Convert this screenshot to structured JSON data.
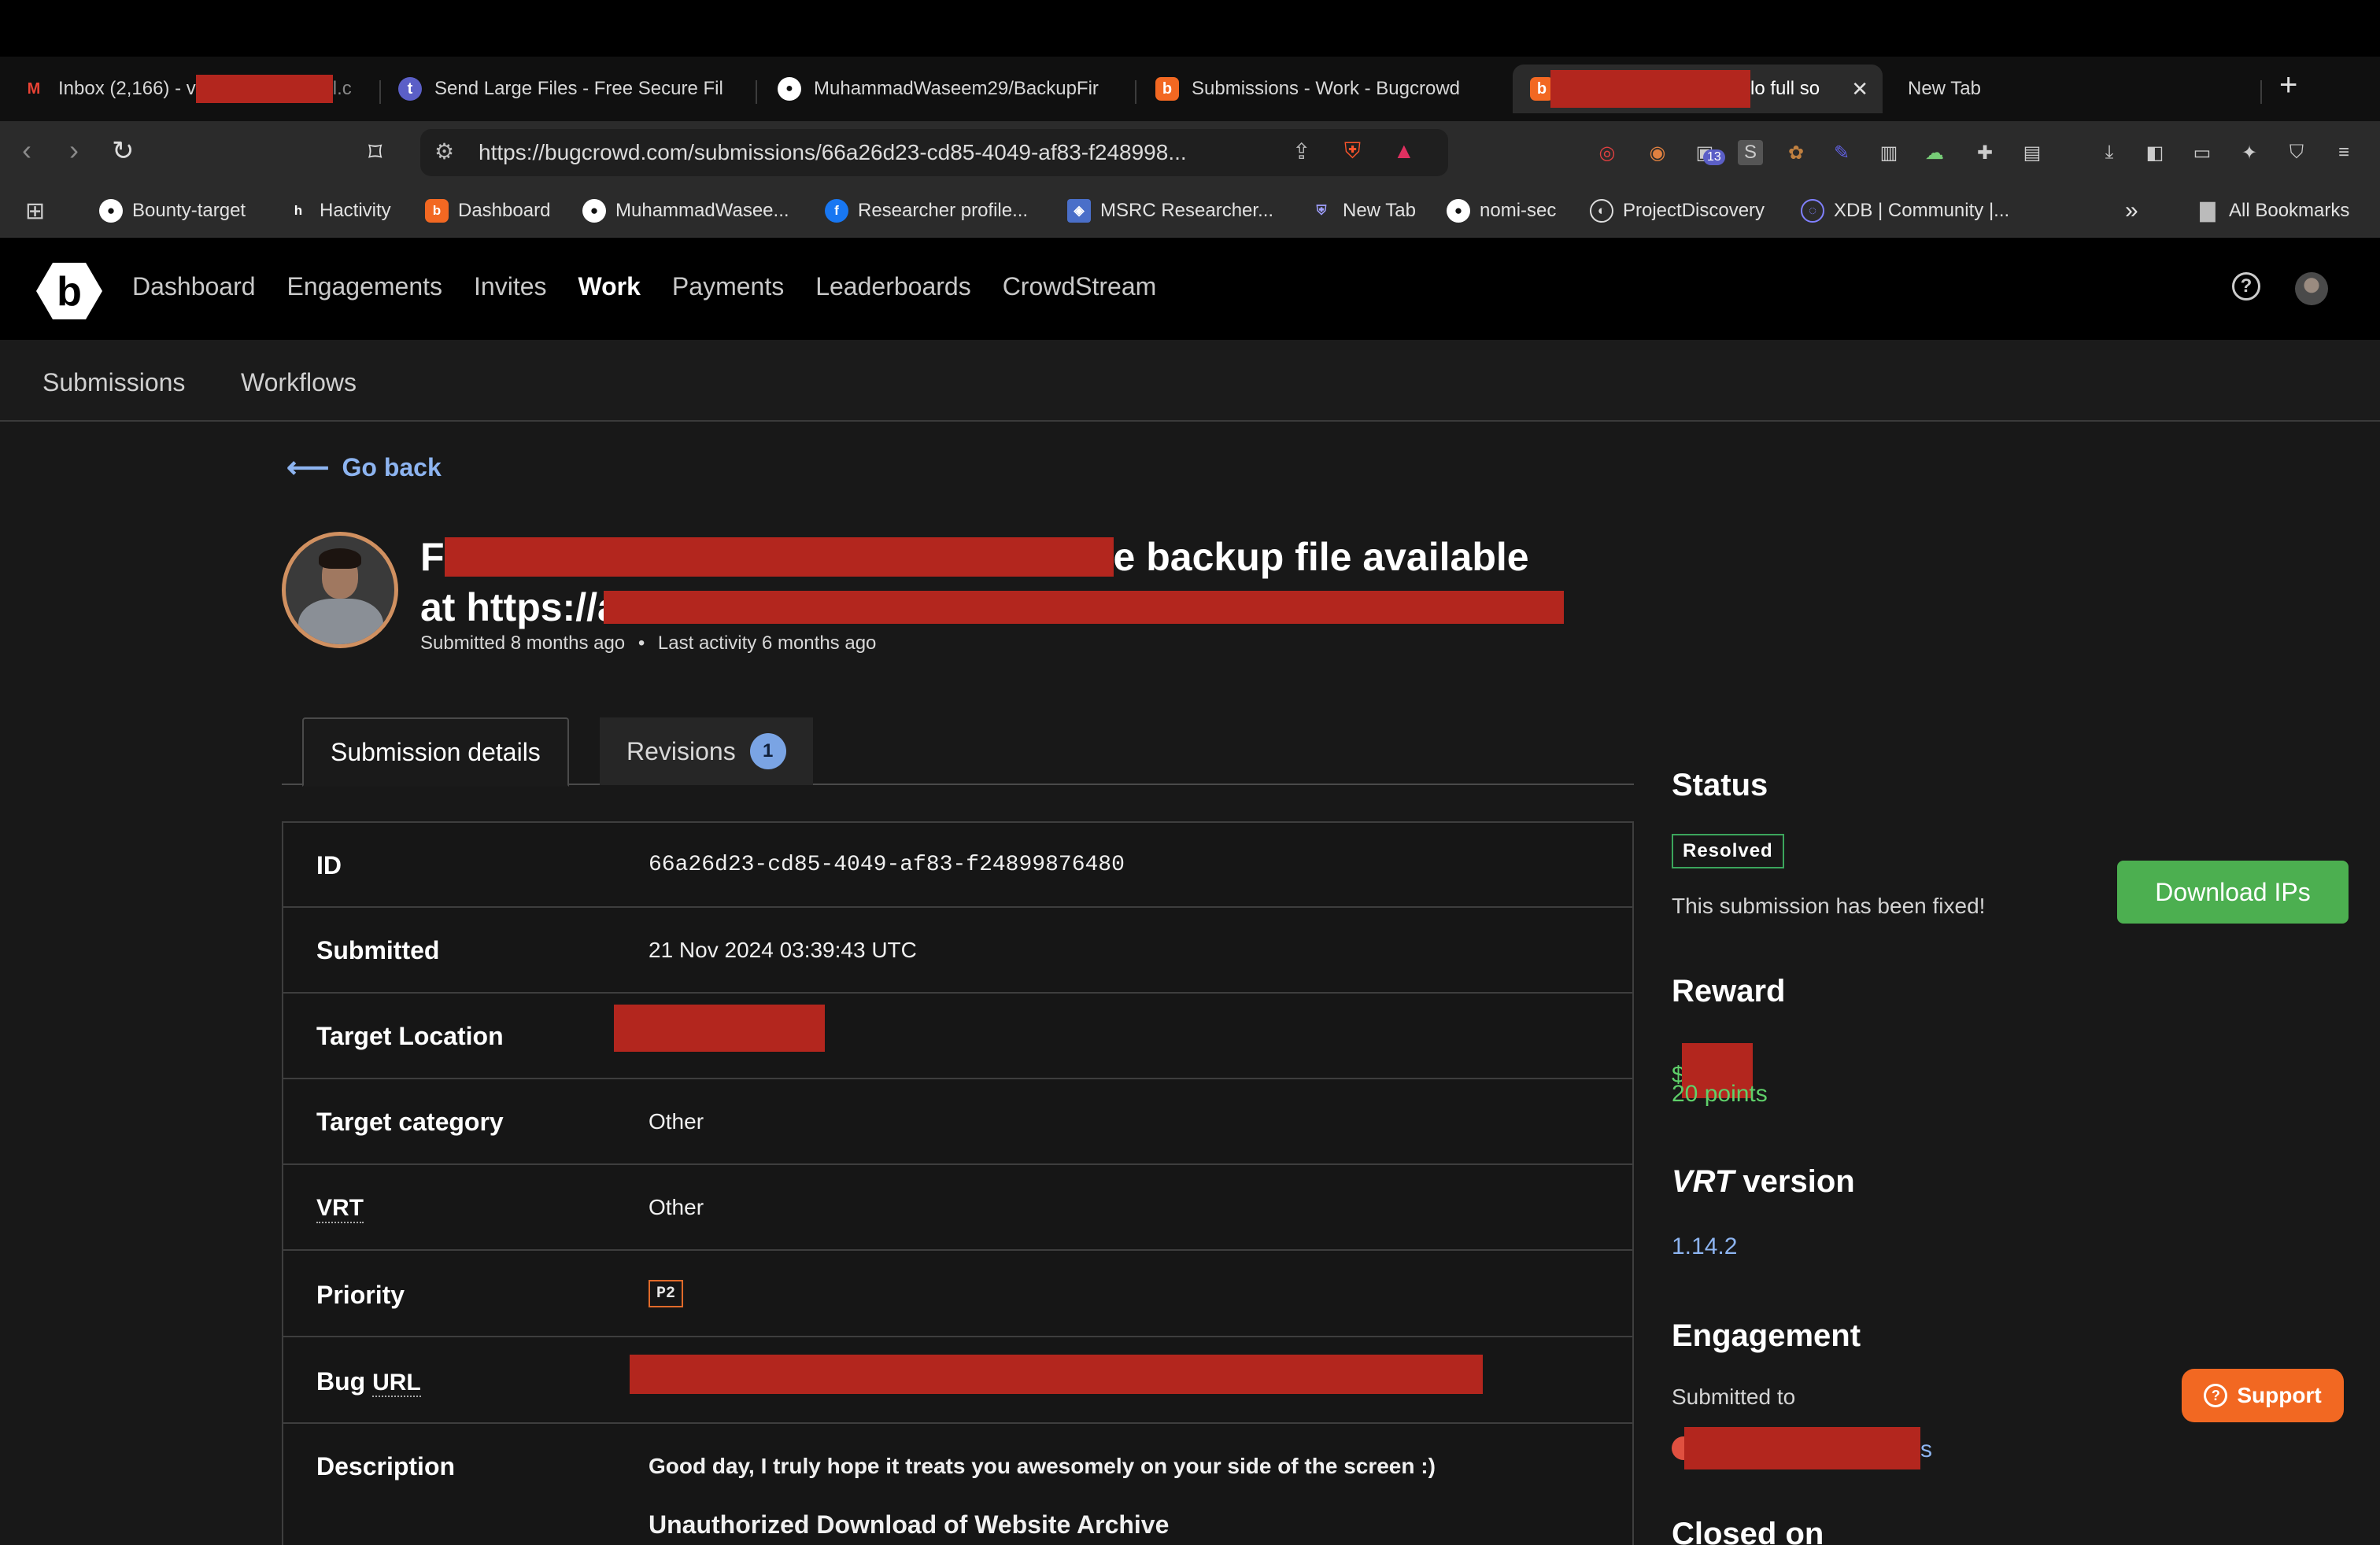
{
  "browser": {
    "tabs": [
      {
        "label": "Inbox (2,166) - v",
        "suffix": "l.c",
        "icon": "gmail-icon"
      },
      {
        "label": "Send Large Files - Free Secure Fil",
        "icon": "transfer-icon"
      },
      {
        "label": "MuhammadWaseem29/BackupFir",
        "icon": "github-icon"
      },
      {
        "label": "Submissions - Work - Bugcrowd",
        "icon": "bugcrowd-icon"
      },
      {
        "label": "lo full so",
        "icon": "bugcrowd-icon",
        "active": true
      },
      {
        "label": "New Tab"
      }
    ],
    "url": "https://bugcrowd.com/submissions/66a26d23-cd85-4049-af83-f248998...",
    "extension_badge": "13",
    "bookmarks": [
      "Bounty-target",
      "Hactivity",
      "Dashboard",
      "MuhammadWasee...",
      "Researcher profile...",
      "MSRC Researcher...",
      "New Tab",
      "nomi-sec",
      "ProjectDiscovery",
      "XDB | Community |...",
      "All Bookmarks"
    ]
  },
  "site": {
    "nav": [
      "Dashboard",
      "Engagements",
      "Invites",
      "Work",
      "Payments",
      "Leaderboards",
      "CrowdStream"
    ],
    "current_nav": "Work",
    "subnav": [
      "Submissions",
      "Workflows"
    ]
  },
  "page": {
    "go_back": "Go back",
    "title_line1_start": "F",
    "title_line1_end": "e backup file available",
    "title_line2_start": "at https://a",
    "submitted_meta": "Submitted 8 months ago",
    "activity_meta": "Last activity 6 months ago",
    "tabs": {
      "details": "Submission details",
      "revisions": "Revisions",
      "revisions_count": "1"
    },
    "details": {
      "id_label": "ID",
      "id_value": "66a26d23-cd85-4049-af83-f24899876480",
      "submitted_label": "Submitted",
      "submitted_value": "21 Nov 2024 03:39:43 UTC",
      "target_location_label": "Target Location",
      "target_category_label": "Target category",
      "target_category_value": "Other",
      "vrt_label": "VRT",
      "vrt_value": "Other",
      "priority_label": "Priority",
      "priority_value": "P2",
      "bug_url_label_prefix": "Bug ",
      "bug_url_label_abbr": "URL",
      "description_label": "Description",
      "description_line1": "Good day, I truly hope it treats you awesomely on your side of the screen :)",
      "description_line2": "Unauthorized Download of Website Archive"
    },
    "sidebar": {
      "status_heading": "Status",
      "status_badge": "Resolved",
      "status_text": "This submission has been fixed!",
      "download_button": "Download IPs",
      "reward_heading": "Reward",
      "reward_prefix": "$",
      "reward_points": "20 points",
      "vrt_heading_logo": "VRT",
      "vrt_heading_word": "version",
      "vrt_version": "1.14.2",
      "engagement_heading": "Engagement",
      "submitted_to": "Submitted to",
      "engagement_suffix": "s",
      "closed_on_heading": "Closed on"
    },
    "support_button": "Support"
  },
  "colors": {
    "accent_blue": "#8db4f0",
    "green": "#5fd06a",
    "bugcrowd_orange": "#f26822",
    "redaction": "#b3261e"
  }
}
